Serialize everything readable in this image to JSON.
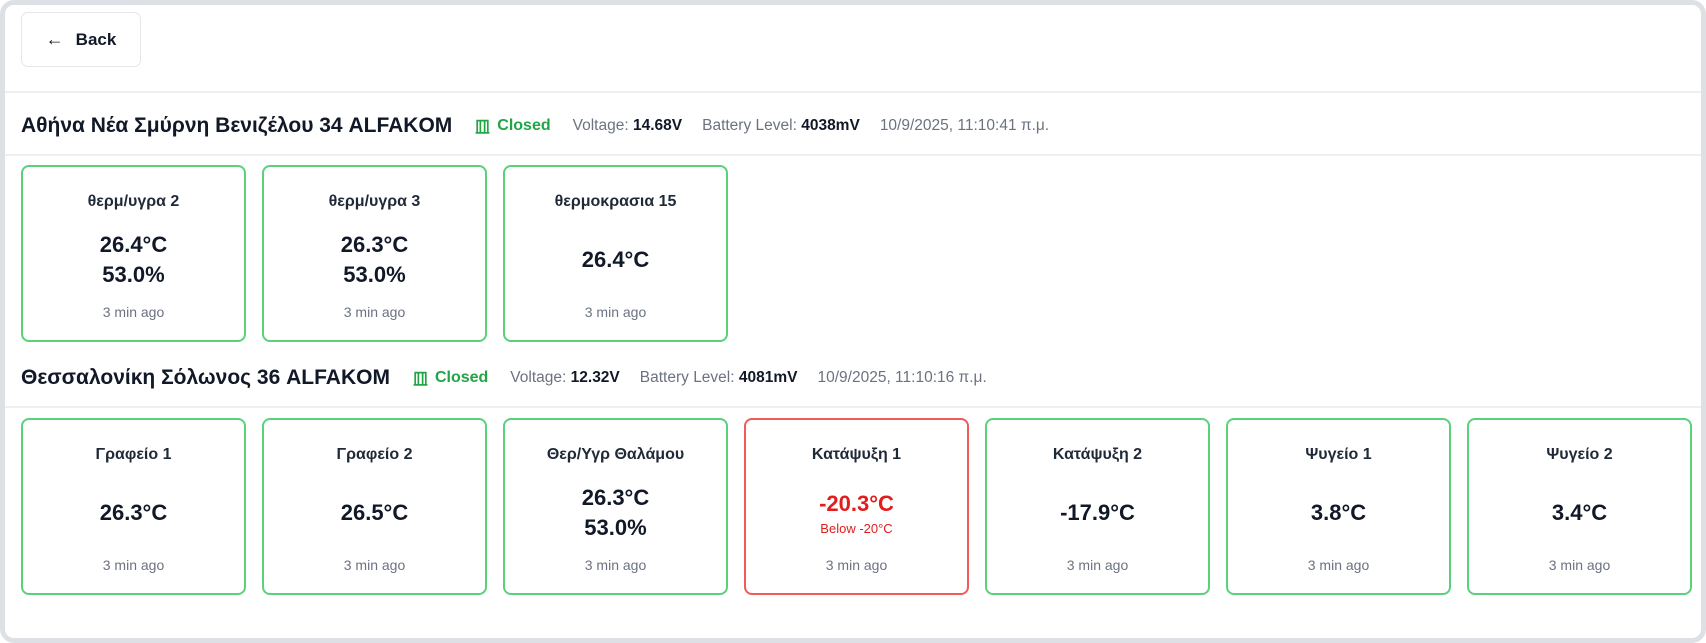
{
  "nav": {
    "back_label": "Back",
    "back_icon": "arrow-left-icon"
  },
  "colors": {
    "ok_border": "#5ad17a",
    "alarm_border": "#ef5b5b",
    "alarm_text": "#e11d1d",
    "closed_green": "#22a447"
  },
  "locations": [
    {
      "name": "Αθήνα Νέα Σμύρνη Βενιζέλου 34 ALFAKOM",
      "door_status": "Closed",
      "voltage_label": "Voltage:",
      "voltage": "14.68V",
      "battery_label": "Battery Level:",
      "battery": "4038mV",
      "timestamp": "10/9/2025, 11:10:41 π.μ.",
      "sensors": [
        {
          "name": "θερμ/υγρα 2",
          "temp": "26.4°C",
          "humidity": "53.0%",
          "updated": "3 min ago"
        },
        {
          "name": "θερμ/υγρα 3",
          "temp": "26.3°C",
          "humidity": "53.0%",
          "updated": "3 min ago"
        },
        {
          "name": "θερμοκρασια 15",
          "temp": "26.4°C",
          "updated": "3 min ago"
        }
      ]
    },
    {
      "name": "Θεσσαλονίκη Σόλωνος 36 ALFAKOM",
      "door_status": "Closed",
      "voltage_label": "Voltage:",
      "voltage": "12.32V",
      "battery_label": "Battery Level:",
      "battery": "4081mV",
      "timestamp": "10/9/2025, 11:10:16 π.μ.",
      "sensors": [
        {
          "name": "Γραφείο 1",
          "temp": "26.3°C",
          "updated": "3 min ago"
        },
        {
          "name": "Γραφείο 2",
          "temp": "26.5°C",
          "updated": "3 min ago"
        },
        {
          "name": "Θερ/Υγρ Θαλάμου",
          "temp": "26.3°C",
          "humidity": "53.0%",
          "updated": "3 min ago"
        },
        {
          "name": "Κατάψυξη 1",
          "temp": "-20.3°C",
          "alert": "Below -20°C",
          "updated": "3 min ago"
        },
        {
          "name": "Κατάψυξη 2",
          "temp": "-17.9°C",
          "updated": "3 min ago"
        },
        {
          "name": "Ψυγείο 1",
          "temp": "3.8°C",
          "updated": "3 min ago"
        },
        {
          "name": "Ψυγείο 2",
          "temp": "3.4°C",
          "updated": "3 min ago"
        }
      ]
    }
  ]
}
